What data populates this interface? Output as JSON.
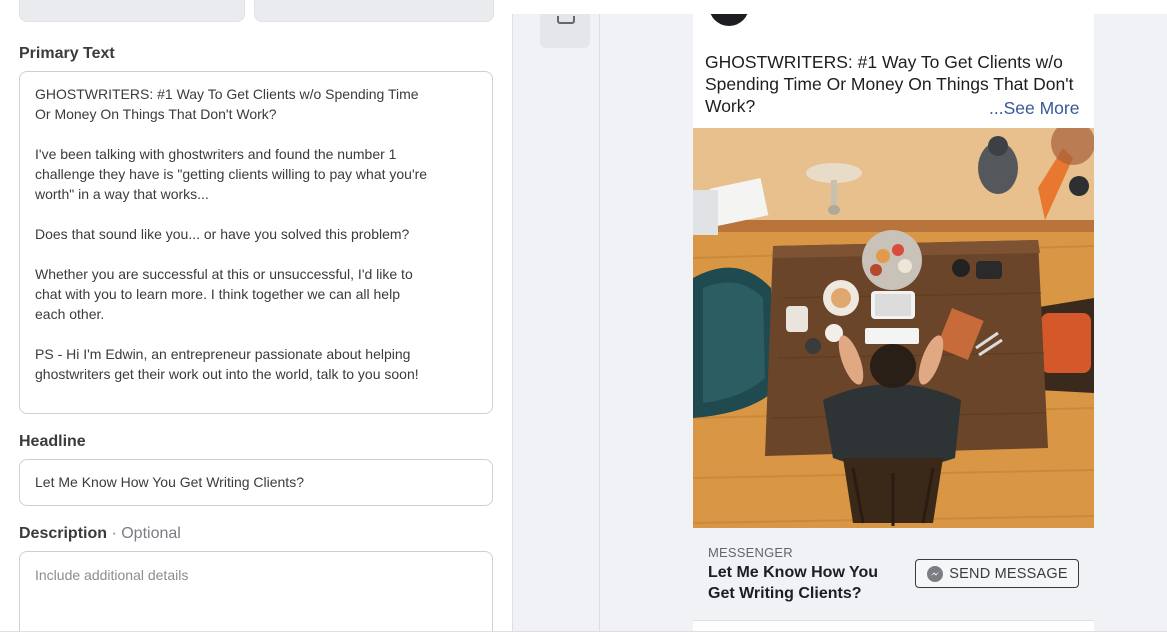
{
  "editor": {
    "primary_text_label": "Primary Text",
    "primary_text_paragraphs": [
      "GHOSTWRITERS: #1 Way To Get Clients w/o Spending Time Or Money On Things That Don't Work?",
      "I've been talking with ghostwriters and found the number 1 challenge they have is \"getting clients willing to pay what you're worth\" in a way that works...",
      "Does that sound like you... or have you solved this problem?",
      "Whether you are successful at this or unsuccessful, I'd like to chat with you to learn more. I think together we can all help each other.",
      "PS - Hi I'm Edwin, an entrepreneur passionate about helping ghostwriters get their work out into the world, talk to you soon!"
    ],
    "headline_label": "Headline",
    "headline_value": "Let Me Know How You Get Writing Clients?",
    "description_label": "Description",
    "description_optional": " · Optional",
    "description_placeholder": "Include additional details"
  },
  "preview": {
    "post_text": "GHOSTWRITERS: #1 Way To Get Clients w/o Spending Time Or Money On Things That Don't Work?",
    "see_more": "...See More",
    "cta_kicker": "MESSENGER",
    "cta_headline": "Let Me Know How You Get Writing Clients?",
    "cta_button": "SEND MESSAGE",
    "image_icon": "ad-photo-man-at-desk"
  },
  "colors": {
    "link": "#385898",
    "panel_bg": "#f0f2f5",
    "border": "#ccd0d5"
  }
}
